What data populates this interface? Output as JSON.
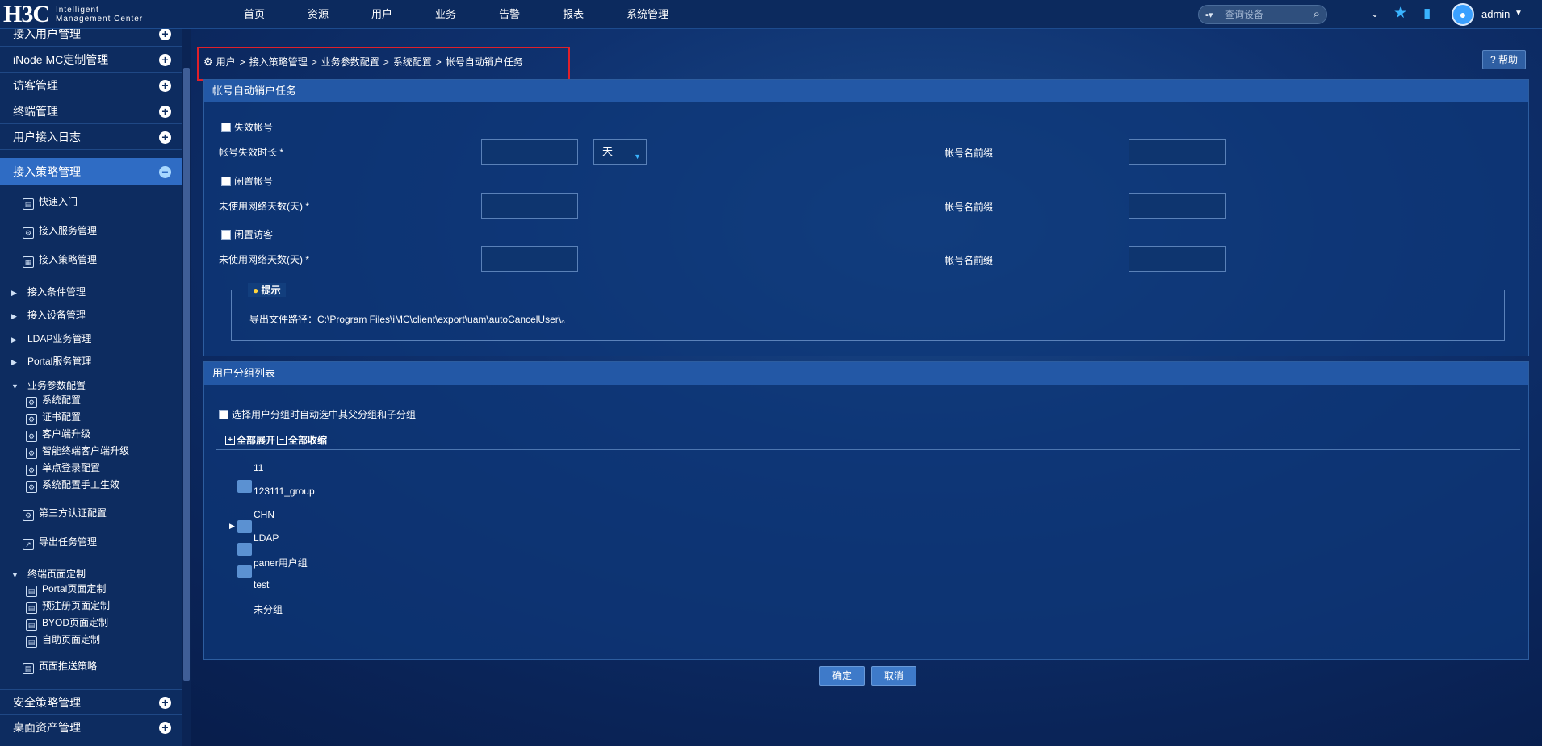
{
  "app": {
    "logo": "H3C",
    "logo_line1": "Intelligent",
    "logo_line2": "Management Center"
  },
  "topnav": [
    "首页",
    "资源",
    "用户",
    "业务",
    "告警",
    "报表",
    "系统管理"
  ],
  "search": {
    "placeholder": "查询设备"
  },
  "user": {
    "name": "admin"
  },
  "sidebar": {
    "top_partial": "接入用户管理",
    "categories": [
      "iNode MC定制管理",
      "访客管理",
      "终端管理",
      "用户接入日志",
      "接入策略管理"
    ],
    "sub_items": [
      "快速入门",
      "接入服务管理",
      "接入策略管理"
    ],
    "groups": [
      "接入条件管理",
      "接入设备管理",
      "LDAP业务管理",
      "Portal服务管理",
      "业务参数配置"
    ],
    "biz_params": [
      "系统配置",
      "证书配置",
      "客户端升级",
      "智能终端客户端升级",
      "单点登录配置",
      "系统配置手工生效"
    ],
    "third_party": "第三方认证配置",
    "export_tasks": "导出任务管理",
    "terminal_page": "终端页面定制",
    "terminal_page_items": [
      "Portal页面定制",
      "预注册页面定制",
      "BYOD页面定制",
      "自助页面定制"
    ],
    "push_policy": "页面推送策略",
    "bottom_categories": [
      "安全策略管理",
      "桌面资产管理"
    ]
  },
  "breadcrumb": [
    "用户",
    "接入策略管理",
    "业务参数配置",
    "系统配置",
    "帐号自动销户任务"
  ],
  "help_label": "帮助",
  "panel1": {
    "title": "帐号自动销户任务",
    "invalid_account": "失效帐号",
    "invalid_duration": "帐号失效时长 *",
    "unit": "天",
    "prefix": "帐号名前缀",
    "idle_account": "闲置帐号",
    "unused_days": "未使用网络天数(天) *",
    "idle_guest": "闲置访客",
    "tip_title": "提示",
    "tip_text": "导出文件路径：C:\\Program Files\\iMC\\client\\export\\uam\\autoCancelUser\\。"
  },
  "panel2": {
    "title": "用户分组列表",
    "auto_select": "选择用户分组时自动选中其父分组和子分组",
    "expand_all": "全部展开",
    "collapse_all": "全部收缩",
    "groups": [
      "11",
      "123111_group",
      "CHN",
      "LDAP",
      "paner用户组",
      "test",
      "未分组"
    ]
  },
  "buttons": {
    "ok": "确定",
    "cancel": "取消"
  }
}
